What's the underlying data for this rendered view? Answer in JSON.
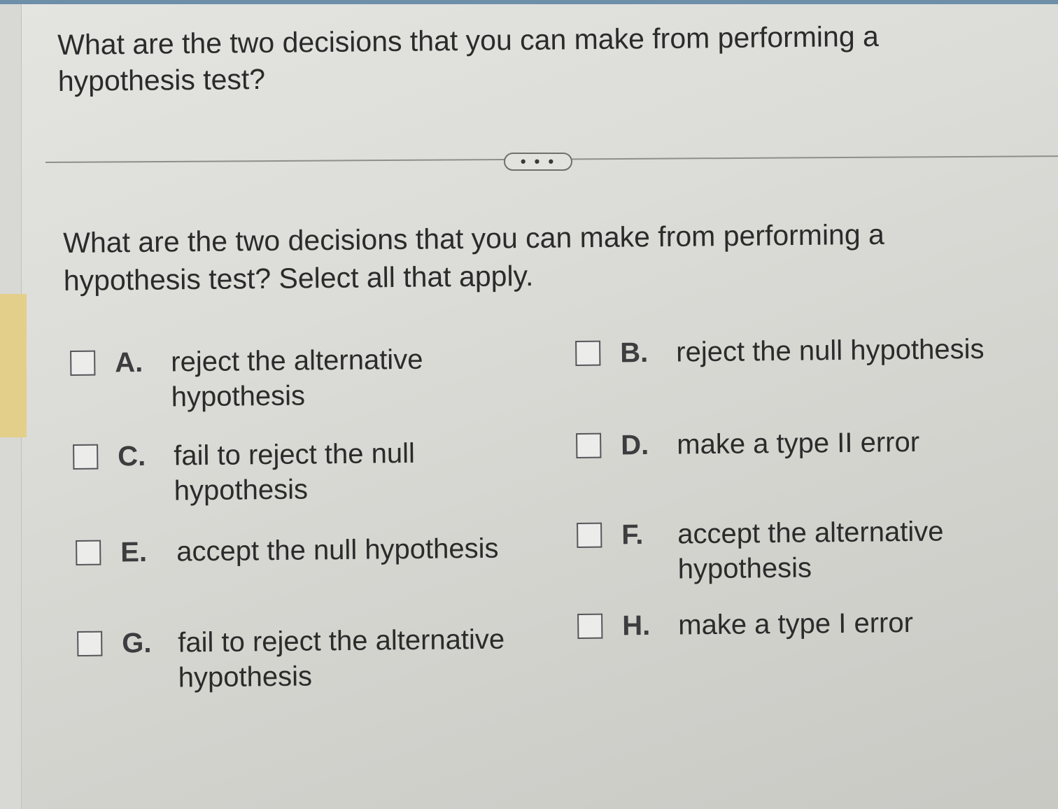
{
  "question": {
    "header": "What are the two decisions that you can make from performing a hypothesis test?",
    "prompt": "What are the two decisions that you can make from performing a hypothesis test? Select all that apply."
  },
  "more_button": {
    "icon": "ellipsis-icon",
    "label": "• • •"
  },
  "options": [
    {
      "letter": "A.",
      "text": "reject the alternative hypothesis",
      "checked": false
    },
    {
      "letter": "B.",
      "text": "reject the null hypothesis",
      "checked": false
    },
    {
      "letter": "C.",
      "text": "fail to reject the null hypothesis",
      "checked": false
    },
    {
      "letter": "D.",
      "text": "make a type II error",
      "checked": false
    },
    {
      "letter": "E.",
      "text": "accept the null hypothesis",
      "checked": false
    },
    {
      "letter": "F.",
      "text": "accept the alternative hypothesis",
      "checked": false
    },
    {
      "letter": "G.",
      "text": "fail to reject the alternative hypothesis",
      "checked": false
    },
    {
      "letter": "H.",
      "text": "make a type I error",
      "checked": false
    }
  ],
  "colors": {
    "accent_bar": "#6e8fa8",
    "highlight": "#e3cf8a"
  }
}
